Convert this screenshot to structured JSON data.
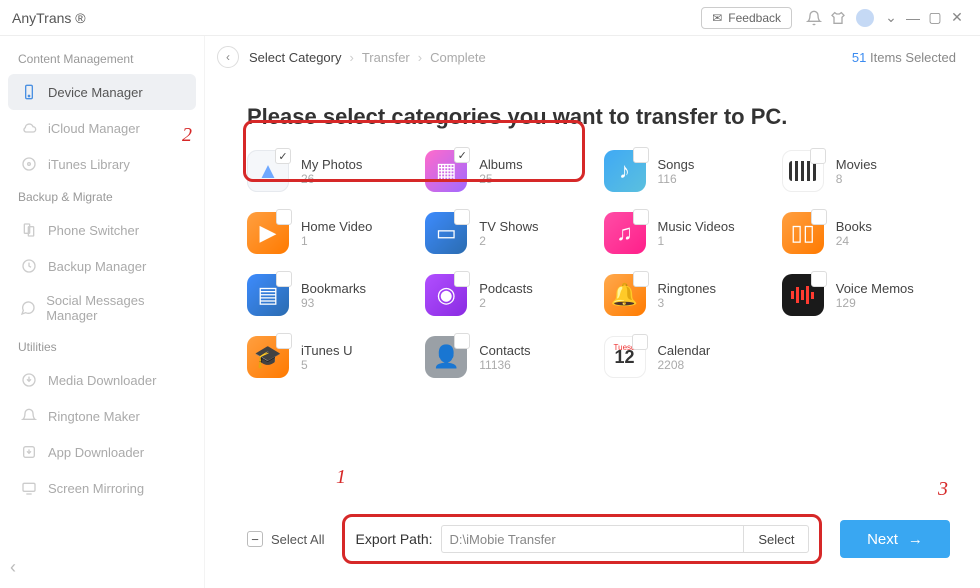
{
  "app": {
    "title": "AnyTrans ®"
  },
  "titlebar": {
    "feedback": "Feedback"
  },
  "sidebar": {
    "headings": {
      "content": "Content Management",
      "backup": "Backup & Migrate",
      "utilities": "Utilities"
    },
    "items": {
      "device": "Device Manager",
      "icloud": "iCloud Manager",
      "itunes": "iTunes Library",
      "phone_switcher": "Phone Switcher",
      "backup_manager": "Backup Manager",
      "social": "Social Messages Manager",
      "media_dl": "Media Downloader",
      "ringtone": "Ringtone Maker",
      "app_dl": "App Downloader",
      "screen": "Screen Mirroring"
    }
  },
  "breadcrumb": {
    "select": "Select Category",
    "transfer": "Transfer",
    "complete": "Complete"
  },
  "selected": {
    "count": "51",
    "label": " Items Selected"
  },
  "subtitle": "Please select categories you want to transfer to PC.",
  "categories": {
    "photos": {
      "name": "My Photos",
      "count": "26",
      "checked": true
    },
    "albums": {
      "name": "Albums",
      "count": "25",
      "checked": true
    },
    "songs": {
      "name": "Songs",
      "count": "116"
    },
    "movies": {
      "name": "Movies",
      "count": "8"
    },
    "home": {
      "name": "Home Video",
      "count": "1"
    },
    "tv": {
      "name": "TV Shows",
      "count": "2"
    },
    "mv": {
      "name": "Music Videos",
      "count": "1"
    },
    "books": {
      "name": "Books",
      "count": "24"
    },
    "bookmarks": {
      "name": "Bookmarks",
      "count": "93"
    },
    "podcasts": {
      "name": "Podcasts",
      "count": "2"
    },
    "ringtones": {
      "name": "Ringtones",
      "count": "3"
    },
    "voice": {
      "name": "Voice Memos",
      "count": "129"
    },
    "itunesu": {
      "name": "iTunes U",
      "count": "5"
    },
    "contacts": {
      "name": "Contacts",
      "count": "11136"
    },
    "calendar": {
      "name": "Calendar",
      "count": "2208"
    }
  },
  "calendar_tile": {
    "day_label": "Tuesd",
    "day_number": "12"
  },
  "footer": {
    "select_all": "Select All",
    "export_label": "Export Path:",
    "export_value": "D:\\iMobie Transfer",
    "select_btn": "Select",
    "next": "Next"
  },
  "annotations": {
    "one": "1",
    "two": "2",
    "three": "3"
  }
}
